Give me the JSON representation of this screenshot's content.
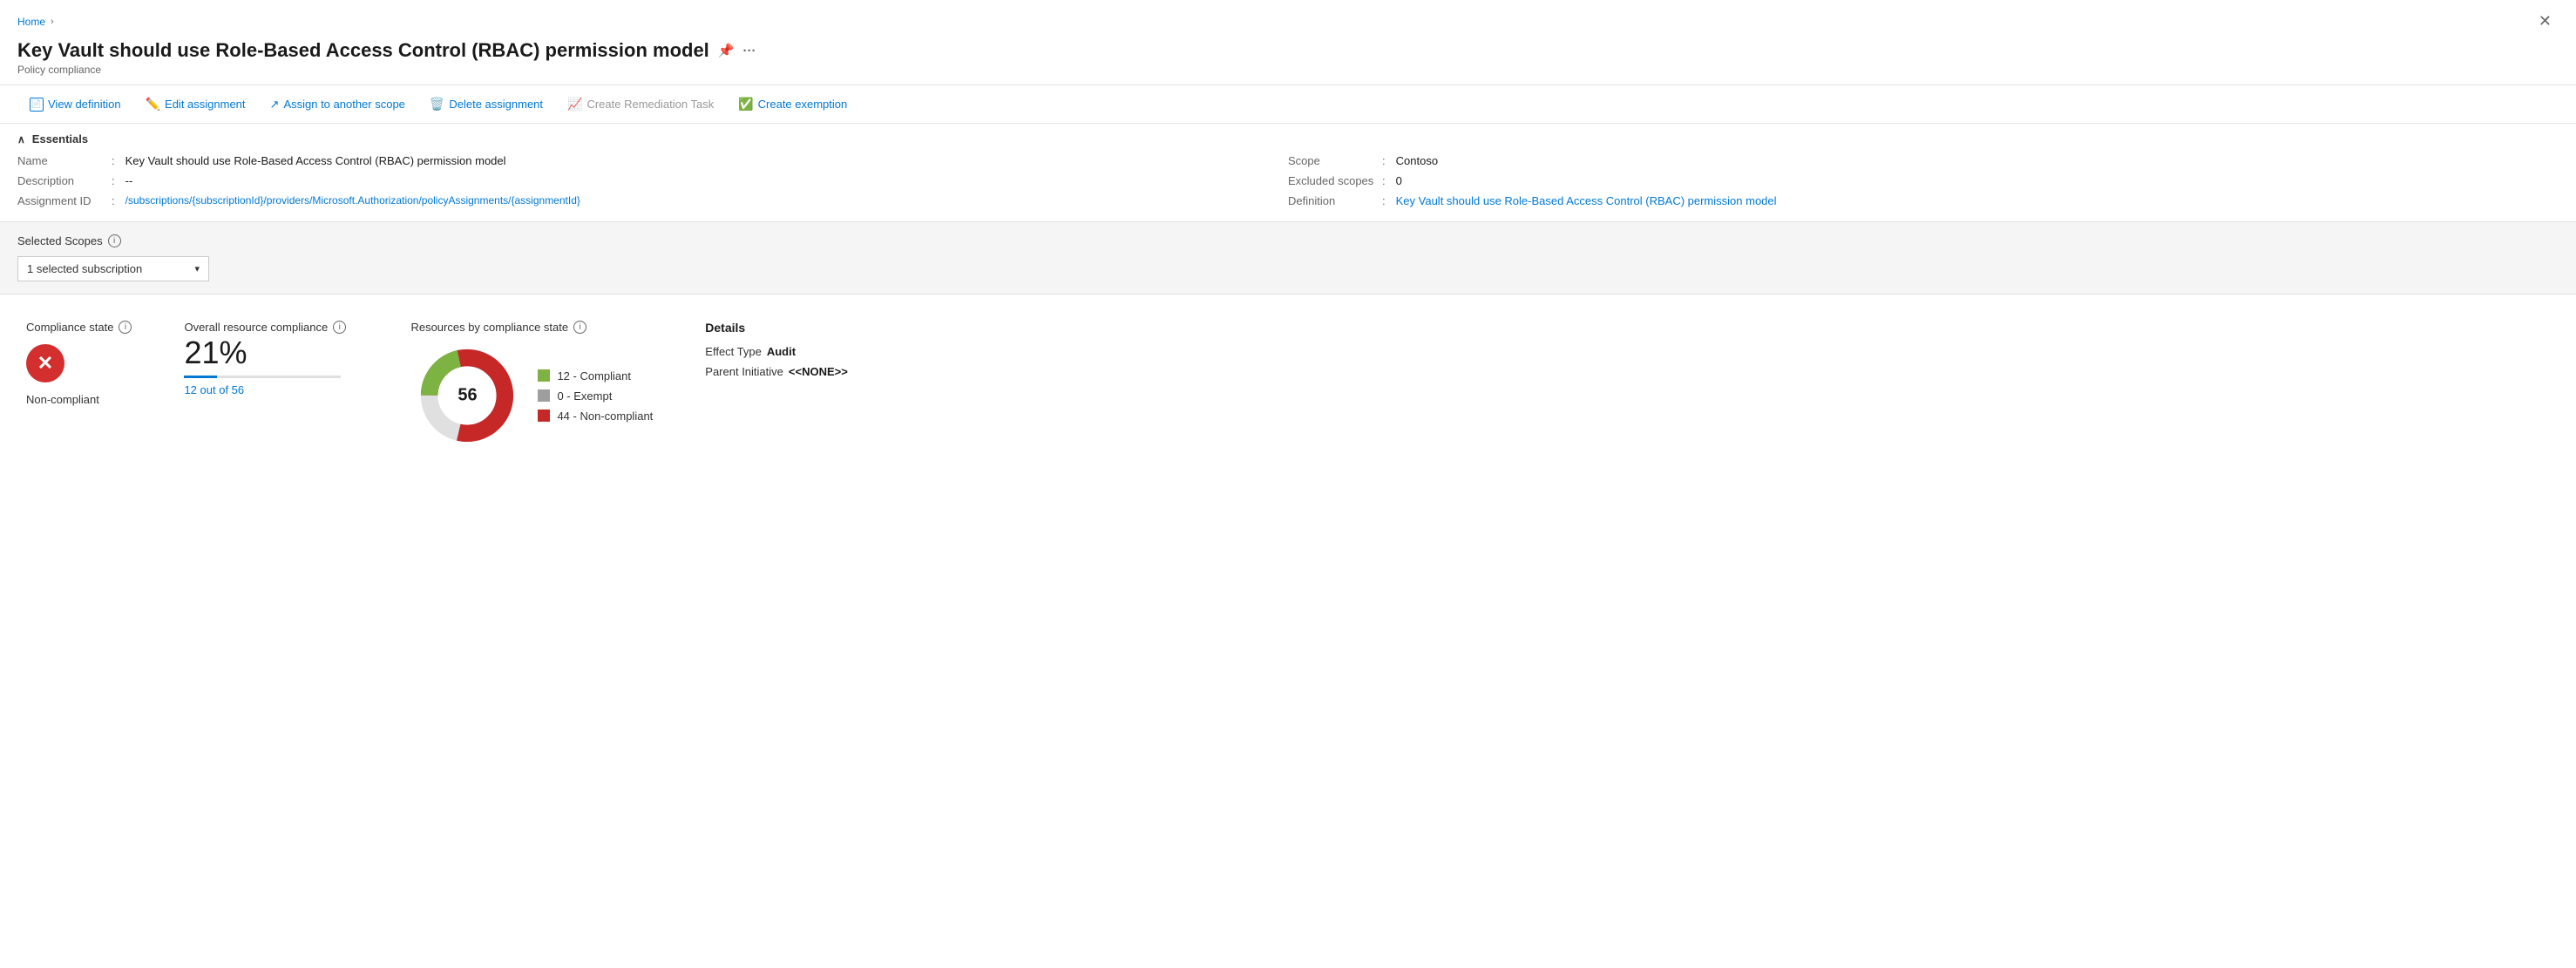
{
  "breadcrumb": {
    "home": "Home",
    "separator": "›"
  },
  "header": {
    "title": "Key Vault should use Role-Based Access Control (RBAC) permission model",
    "subtitle": "Policy compliance",
    "pin_icon": "📌",
    "more_icon": "···"
  },
  "toolbar": {
    "view_definition": "View definition",
    "edit_assignment": "Edit assignment",
    "assign_to_another_scope": "Assign to another scope",
    "delete_assignment": "Delete assignment",
    "create_remediation_task": "Create Remediation Task",
    "create_exemption": "Create exemption"
  },
  "essentials": {
    "header": "Essentials",
    "name_label": "Name",
    "name_value": "Key Vault should use Role-Based Access Control (RBAC) permission model",
    "description_label": "Description",
    "description_value": "--",
    "assignment_id_label": "Assignment ID",
    "assignment_id_value": "/subscriptions/{subscriptionId}/providers/Microsoft.Authorization/policyAssignments/{assignmentId}",
    "scope_label": "Scope",
    "scope_value": "Contoso",
    "excluded_scopes_label": "Excluded scopes",
    "excluded_scopes_value": "0",
    "definition_label": "Definition",
    "definition_value": "Key Vault should use Role-Based Access Control (RBAC) permission model"
  },
  "selected_scopes": {
    "label": "Selected Scopes",
    "dropdown_value": "1 selected subscription"
  },
  "compliance_state": {
    "title": "Compliance state",
    "state": "Non-compliant",
    "color": "#d32f2f"
  },
  "overall_compliance": {
    "title": "Overall resource compliance",
    "percentage": "21%",
    "out_of": "12 out of 56",
    "fill_pct": 21
  },
  "resources_by_state": {
    "title": "Resources by compliance state",
    "total": "56",
    "legend": [
      {
        "label": "12 - Compliant",
        "color": "#7cb342"
      },
      {
        "label": "0 - Exempt",
        "color": "#9e9e9e"
      },
      {
        "label": "44 - Non-compliant",
        "color": "#c62828"
      }
    ],
    "donut": {
      "compliant": 12,
      "exempt": 0,
      "non_compliant": 44,
      "total": 56
    }
  },
  "details": {
    "title": "Details",
    "effect_type_label": "Effect Type",
    "effect_type_value": "Audit",
    "parent_initiative_label": "Parent Initiative",
    "parent_initiative_value": "<<NONE>>"
  },
  "close_label": "✕"
}
